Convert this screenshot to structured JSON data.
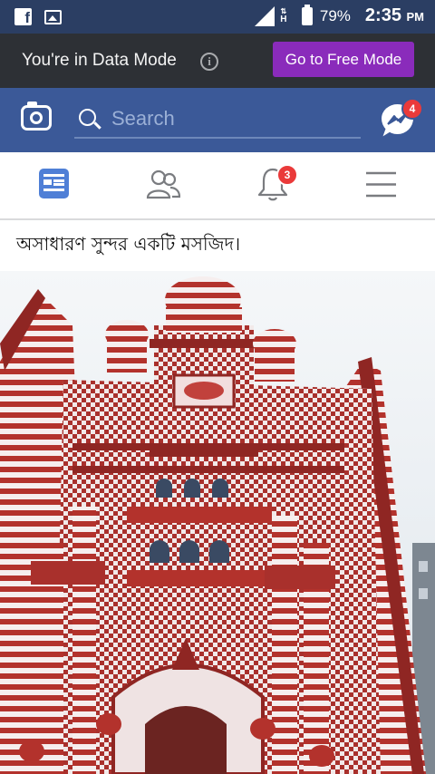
{
  "status_bar": {
    "battery": "79%",
    "time": "2:35",
    "ampm": "PM",
    "network": "H",
    "icons": [
      "facebook-icon",
      "gallery-icon",
      "signal-icon",
      "battery-icon"
    ]
  },
  "data_mode": {
    "message": "You're in Data Mode",
    "button_label": "Go to Free Mode",
    "button_color": "#8a2bbb"
  },
  "header": {
    "search_placeholder": "Search",
    "messenger_badge": "4",
    "brand_color": "#3b5998"
  },
  "nav": {
    "items": [
      "news-feed-icon",
      "friends-icon",
      "notifications-icon",
      "menu-icon"
    ],
    "notifications_badge": "3",
    "active_color": "#4f7fd6"
  },
  "post": {
    "text": "অসাধারণ সুন্দর একটি মসজিদ।",
    "image_description_icon": "mosque-photo"
  }
}
